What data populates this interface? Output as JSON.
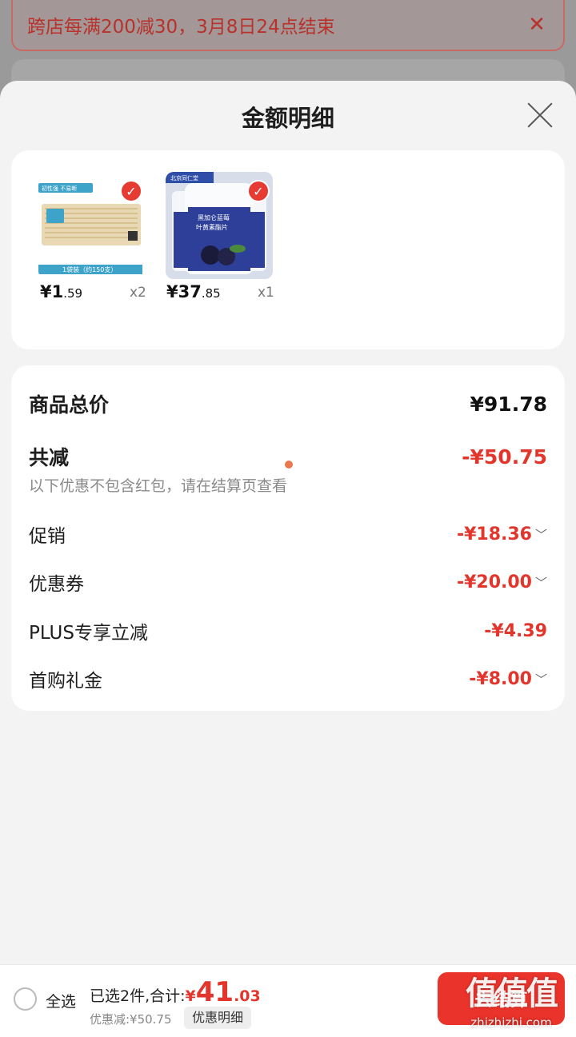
{
  "banner": {
    "text": "跨店每满200减30，3月8日24点结束",
    "close": "✕"
  },
  "sheet": {
    "title": "金额明细"
  },
  "products": [
    {
      "price_int": "¥1",
      "price_dec": ".59",
      "qty": "x2",
      "image": "toothpick-pack"
    },
    {
      "price_int": "¥37",
      "price_dec": ".85",
      "qty": "x1",
      "image": "supplement-bottles"
    }
  ],
  "detail": {
    "total_label": "商品总价",
    "total_value": "¥91.78",
    "reduce_label": "共减",
    "reduce_value": "-¥50.75",
    "note": "以下优惠不包含红包，请在结算页查看",
    "rows": [
      {
        "label": "促销",
        "value": "-¥18.36",
        "expandable": true
      },
      {
        "label": "优惠券",
        "value": "-¥20.00",
        "expandable": true
      },
      {
        "label": "PLUS专享立减",
        "value": "-¥4.39",
        "expandable": false
      },
      {
        "label": "首购礼金",
        "value": "-¥8.00",
        "expandable": true
      }
    ]
  },
  "bottom": {
    "select_all": "全选",
    "sum_label": "已选2件,合计:",
    "sum_currency": "¥",
    "sum_int": "41",
    "sum_dec": ".03",
    "discount": "优惠减:¥50.75",
    "detail_link": "优惠明细",
    "checkout": "去结算"
  },
  "watermark": {
    "logo": "值值值",
    "url": "zhizhizhi.com"
  },
  "colors": {
    "accent": "#e2352c",
    "sheet_bg": "#f3f3f3"
  }
}
